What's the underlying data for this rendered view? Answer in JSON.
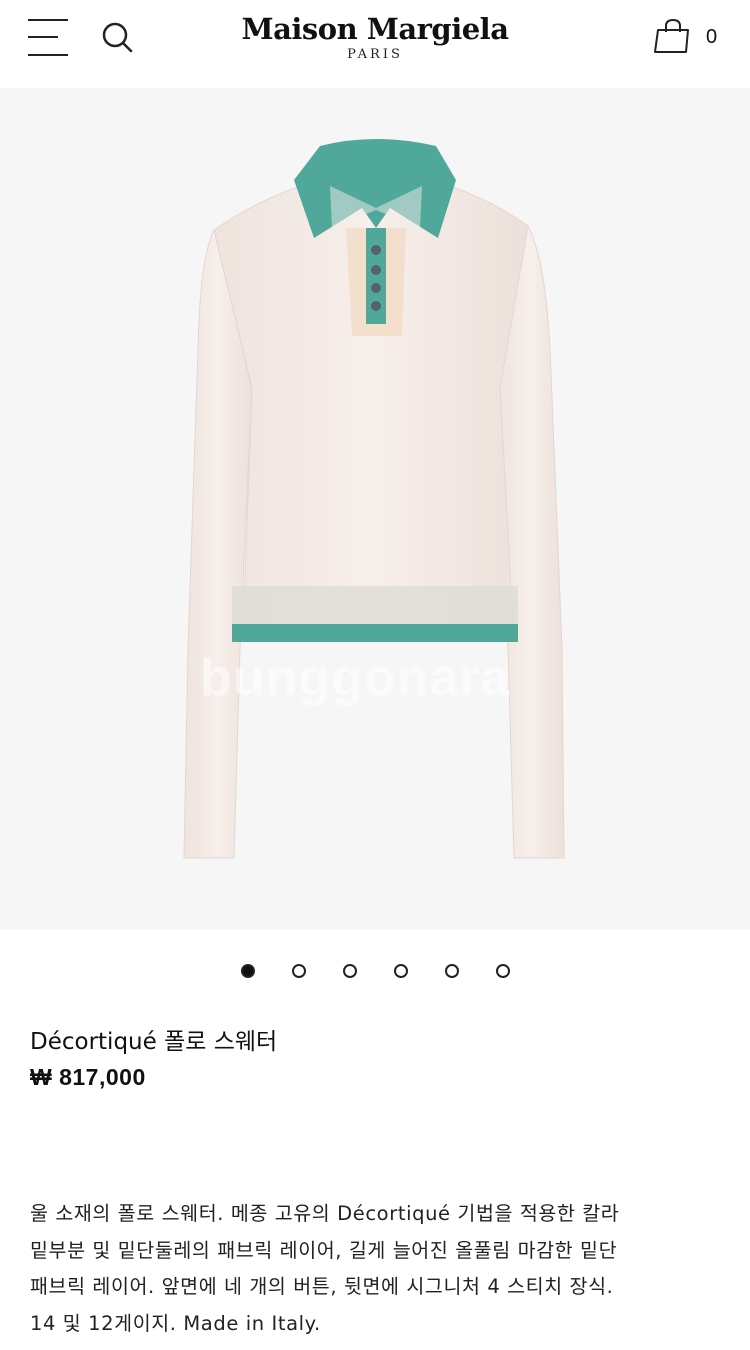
{
  "header": {
    "brand": "Maison Margiela",
    "brand_sub": "PARIS",
    "menu_icon": "hamburger-menu-icon",
    "search_icon": "search-icon",
    "bag_icon": "shopping-bag-icon",
    "bag_count": "0"
  },
  "gallery": {
    "watermark": "bunggonara",
    "total_images": 6,
    "active_index": 0
  },
  "product": {
    "name": "Décortiqué 폴로 스웨터",
    "price": "₩ 817,000",
    "description_lines": [
      "울 소재의 폴로 스웨터. 메종 고유의 Décortiqué 기법을 적용한 칼라",
      "밑부분 및 밑단둘레의 패브릭 레이어, 길게 늘어진 올풀림 마감한 밑단",
      "패브릭 레이어. 앞면에 네 개의 버튼, 뒷면에 시그니처 4 스티치 장식.",
      "14 및 12게이지. Made in Italy."
    ]
  },
  "colors": {
    "sweater_body": "#f3e9e4",
    "collar_green": "#4fa89a",
    "background": "#f6f6f6"
  }
}
